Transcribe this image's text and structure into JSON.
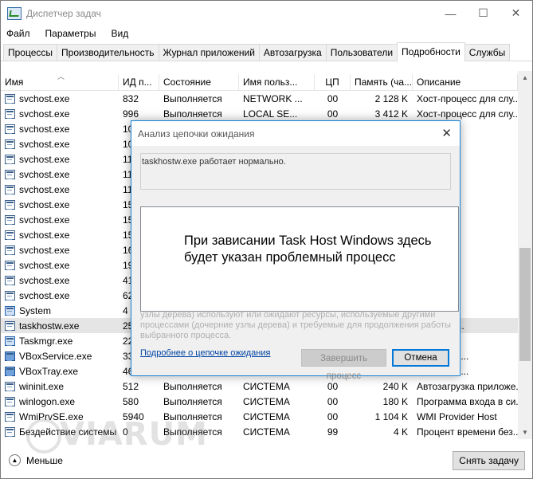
{
  "window": {
    "title": "Диспетчер задач",
    "controls": {
      "minimize": "—",
      "maximize": "☐",
      "close": "✕"
    }
  },
  "menu": [
    "Файл",
    "Параметры",
    "Вид"
  ],
  "tabs": [
    "Процессы",
    "Производительность",
    "Журнал приложений",
    "Автозагрузка",
    "Пользователи",
    "Подробности",
    "Службы"
  ],
  "active_tab": "Подробности",
  "columns": [
    "Имя",
    "ИД п...",
    "Состояние",
    "Имя польз...",
    "ЦП",
    "Память (ча...",
    "Описание"
  ],
  "rows": [
    {
      "name": "svchost.exe",
      "pid": "832",
      "state": "Выполняется",
      "user": "NETWORK ...",
      "cpu": "00",
      "mem": "2 128 K",
      "desc": "Хост-процесс для слу..."
    },
    {
      "name": "svchost.exe",
      "pid": "996",
      "state": "Выполняется",
      "user": "LOCAL SE...",
      "cpu": "00",
      "mem": "3 412 K",
      "desc": "Хост-процесс для слу..."
    },
    {
      "name": "svchost.exe",
      "pid": "10",
      "state": "",
      "user": "",
      "cpu": "",
      "mem": "",
      "desc": "слу..."
    },
    {
      "name": "svchost.exe",
      "pid": "10",
      "state": "",
      "user": "",
      "cpu": "",
      "mem": "",
      "desc": "слу..."
    },
    {
      "name": "svchost.exe",
      "pid": "11",
      "state": "",
      "user": "",
      "cpu": "",
      "mem": "",
      "desc": "слу..."
    },
    {
      "name": "svchost.exe",
      "pid": "11",
      "state": "",
      "user": "",
      "cpu": "",
      "mem": "",
      "desc": "слу..."
    },
    {
      "name": "svchost.exe",
      "pid": "11",
      "state": "",
      "user": "",
      "cpu": "",
      "mem": "",
      "desc": "слу..."
    },
    {
      "name": "svchost.exe",
      "pid": "15",
      "state": "",
      "user": "",
      "cpu": "",
      "mem": "",
      "desc": "слу..."
    },
    {
      "name": "svchost.exe",
      "pid": "15",
      "state": "",
      "user": "",
      "cpu": "",
      "mem": "",
      "desc": "слу..."
    },
    {
      "name": "svchost.exe",
      "pid": "15",
      "state": "",
      "user": "",
      "cpu": "",
      "mem": "",
      "desc": "слу..."
    },
    {
      "name": "svchost.exe",
      "pid": "16",
      "state": "",
      "user": "",
      "cpu": "",
      "mem": "",
      "desc": "слу..."
    },
    {
      "name": "svchost.exe",
      "pid": "19",
      "state": "",
      "user": "",
      "cpu": "",
      "mem": "",
      "desc": "слу..."
    },
    {
      "name": "svchost.exe",
      "pid": "41",
      "state": "",
      "user": "",
      "cpu": "",
      "mem": "",
      "desc": "слу..."
    },
    {
      "name": "svchost.exe",
      "pid": "62",
      "state": "",
      "user": "",
      "cpu": "",
      "mem": "",
      "desc": "слу..."
    },
    {
      "name": "System",
      "pid": "4",
      "state": "",
      "user": "",
      "cpu": "",
      "mem": "",
      "desc": "ystem"
    },
    {
      "name": "taskhostw.exe",
      "pid": "25",
      "state": "",
      "user": "",
      "cpu": "",
      "mem": "",
      "desc": "для задa..."
    },
    {
      "name": "Taskmgr.exe",
      "pid": "22",
      "state": "",
      "user": "",
      "cpu": "",
      "mem": "",
      "desc": ""
    },
    {
      "name": "VBoxService.exe",
      "pid": "33",
      "state": "",
      "user": "",
      "cpu": "",
      "mem": "",
      "desc": "est Additio..."
    },
    {
      "name": "VBoxTray.exe",
      "pid": "46",
      "state": "",
      "user": "",
      "cpu": "",
      "mem": "",
      "desc": "est Additio..."
    },
    {
      "name": "wininit.exe",
      "pid": "512",
      "state": "Выполняется",
      "user": "СИСТЕМА",
      "cpu": "00",
      "mem": "240 K",
      "desc": "Автозагрузка приложе..."
    },
    {
      "name": "winlogon.exe",
      "pid": "580",
      "state": "Выполняется",
      "user": "СИСТЕМА",
      "cpu": "00",
      "mem": "180 K",
      "desc": "Программа входа в си..."
    },
    {
      "name": "WmiPrvSE.exe",
      "pid": "5940",
      "state": "Выполняется",
      "user": "СИСТЕМА",
      "cpu": "00",
      "mem": "1 104 K",
      "desc": "WMI Provider Host"
    },
    {
      "name": "Бездействие системы",
      "pid": "0",
      "state": "Выполняется",
      "user": "СИСТЕМА",
      "cpu": "99",
      "mem": "4 K",
      "desc": "Процент времени без..."
    }
  ],
  "footer": {
    "fewer_label": "Меньше",
    "end_task_label": "Снять задачу"
  },
  "dialog": {
    "title": "Анализ цепочки ожидания",
    "status_text": "taskhostw.exe работает нормально.",
    "overlay_text": "При зависании Task Host Windows здесь будет указан проблемный процесс",
    "hint_text": "узлы дерева) используют или ожидают ресурсы, используемые другими процессами (дочерние узлы дерева) и требуемые для продолжения работы выбранного процесса.",
    "link_text": "Подробнее о цепочке ожидания",
    "end_button": "Завершить процесс",
    "cancel_button": "Отмена"
  },
  "watermark": "VIARUM",
  "colors": {
    "accent": "#0078d7",
    "selection": "#e5e5e5",
    "dialog_border": "#1883d7"
  }
}
